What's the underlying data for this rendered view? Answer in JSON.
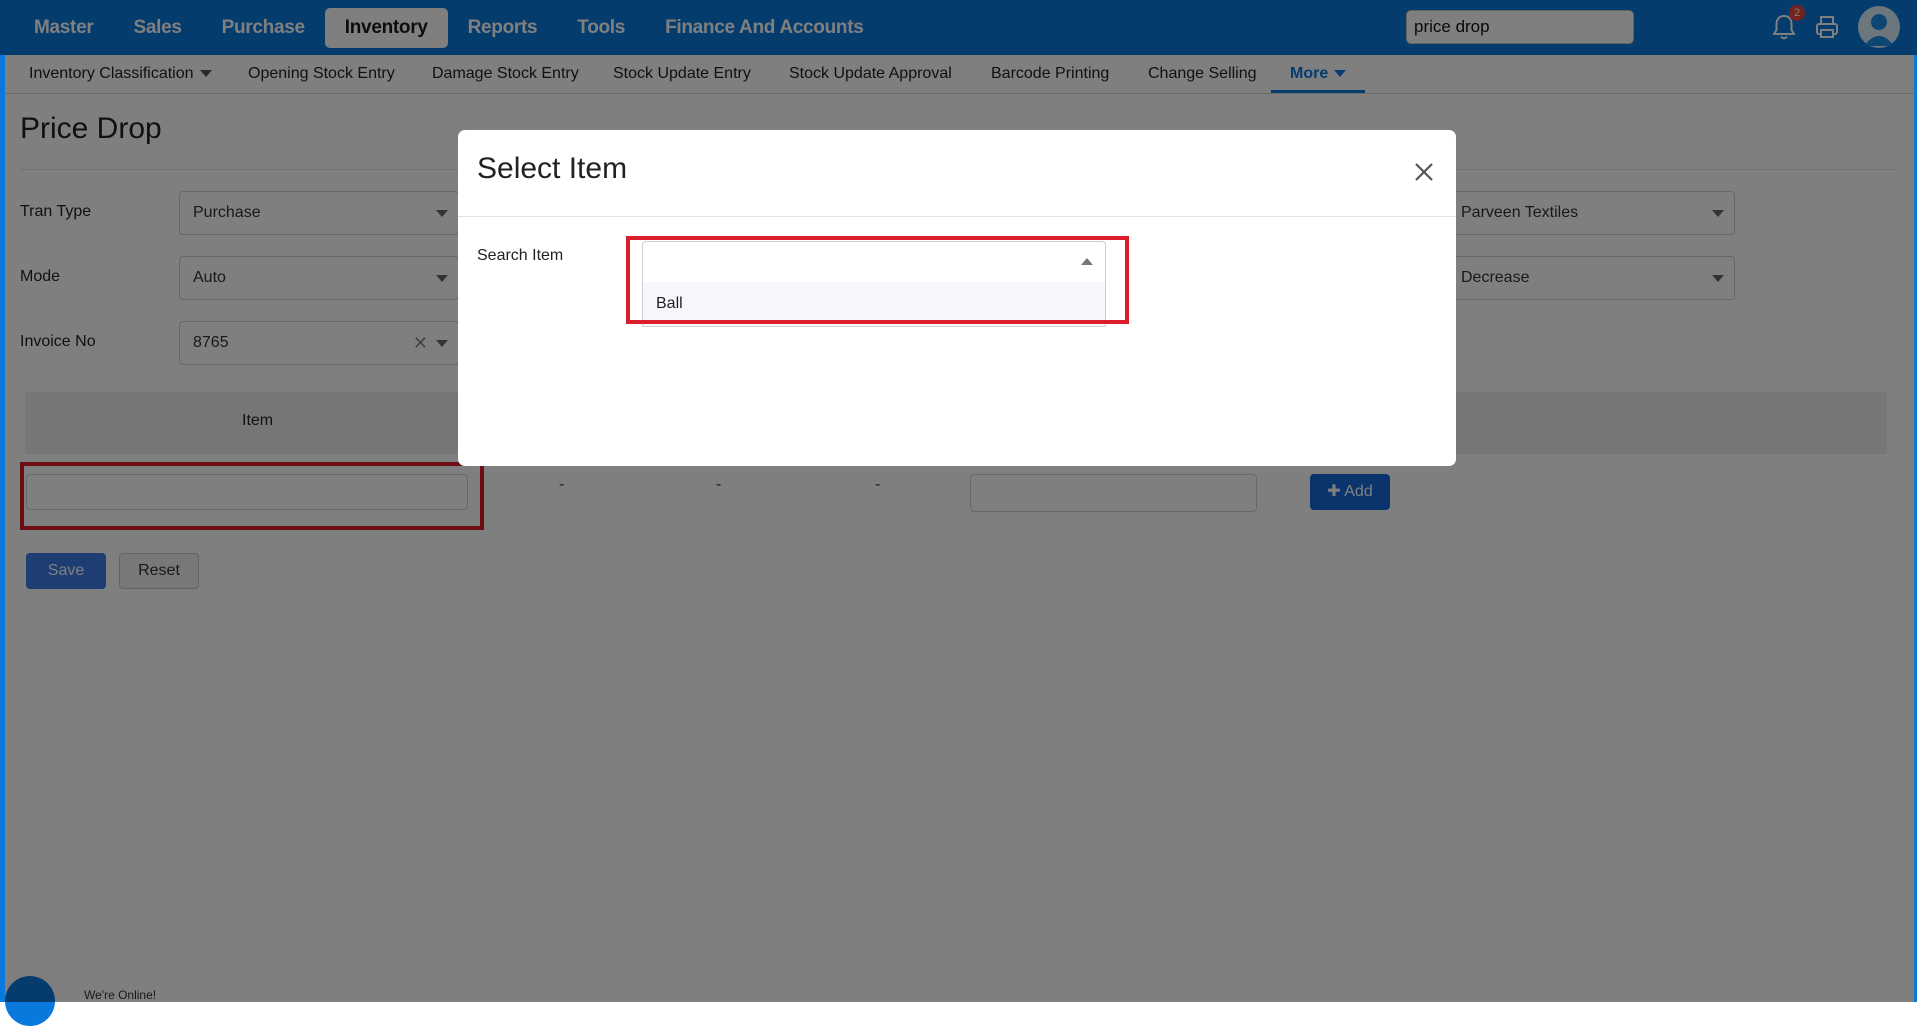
{
  "top_menu": [
    "Master",
    "Sales",
    "Purchase",
    "Inventory",
    "Reports",
    "Tools",
    "Finance And Accounts"
  ],
  "active_top_menu": "Inventory",
  "global_search": {
    "value": "price drop"
  },
  "notification_count": "2",
  "sub_menu": [
    "Inventory Classification",
    "Opening Stock Entry",
    "Damage Stock Entry",
    "Stock Update Entry",
    "Stock Update Approval",
    "Barcode Printing",
    "Change Selling",
    "More"
  ],
  "page": {
    "title": "Price Drop",
    "fields": {
      "tran_type": {
        "label": "Tran Type",
        "value": "Purchase"
      },
      "mode": {
        "label": "Mode",
        "value": "Auto"
      },
      "invoice_no": {
        "label": "Invoice No",
        "value": "8765"
      },
      "party": {
        "value": "Parveen Textiles"
      },
      "direction": {
        "value": "Decrease"
      }
    },
    "grid": {
      "column_item": "Item",
      "placeholders": [
        "-",
        "-",
        "-"
      ]
    },
    "buttons": {
      "add": "Add",
      "save": "Save",
      "reset": "Reset"
    }
  },
  "modal": {
    "title": "Select Item",
    "search_label": "Search Item",
    "search_value": "",
    "options": [
      "Ball"
    ]
  },
  "chat_widget": {
    "text": "We're Online!"
  },
  "colors": {
    "primary": "#0a79dd",
    "highlight": "#d81e2a",
    "add_button": "#1769d8"
  }
}
